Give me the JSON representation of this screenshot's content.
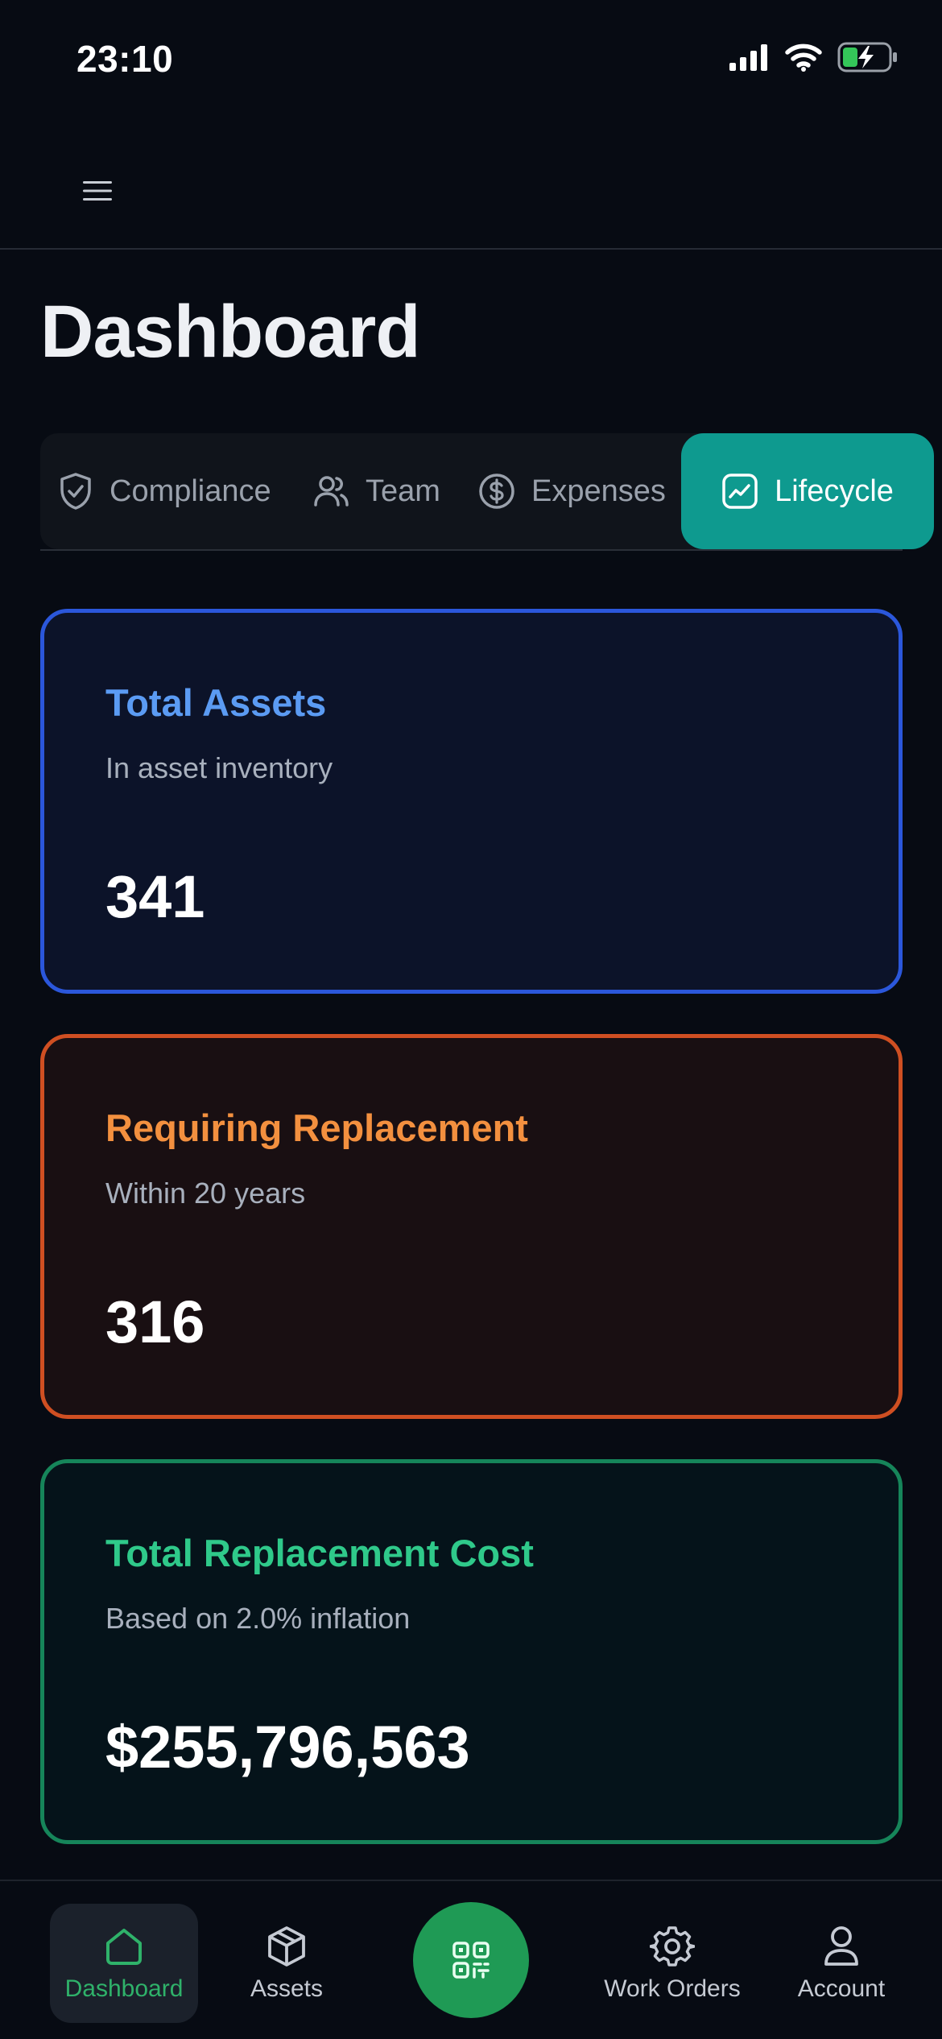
{
  "status_bar": {
    "time": "23:10"
  },
  "page": {
    "title": "Dashboard"
  },
  "tabs": [
    {
      "label": "Compliance",
      "icon": "shield-check-icon",
      "active": false
    },
    {
      "label": "Team",
      "icon": "users-icon",
      "active": false
    },
    {
      "label": "Expenses",
      "icon": "dollar-circle-icon",
      "active": false
    },
    {
      "label": "Lifecycle",
      "icon": "trend-chart-icon",
      "active": true
    }
  ],
  "cards": {
    "total_assets": {
      "title": "Total Assets",
      "subtitle": "In asset inventory",
      "value": "341"
    },
    "requiring_replacement": {
      "title": "Requiring Replacement",
      "subtitle": "Within 20 years",
      "value": "316"
    },
    "total_replacement_cost": {
      "title": "Total Replacement Cost",
      "subtitle": "Based on 2.0% inflation",
      "value": "$255,796,563"
    }
  },
  "bottom_nav": {
    "dashboard": "Dashboard",
    "assets": "Assets",
    "work_orders": "Work Orders",
    "account": "Account"
  },
  "colors": {
    "accent_teal": "#0e9a8f",
    "blue": "#2b57db",
    "orange": "#cf4f22",
    "green": "#16855a",
    "nav_active": "#2fb26a"
  }
}
